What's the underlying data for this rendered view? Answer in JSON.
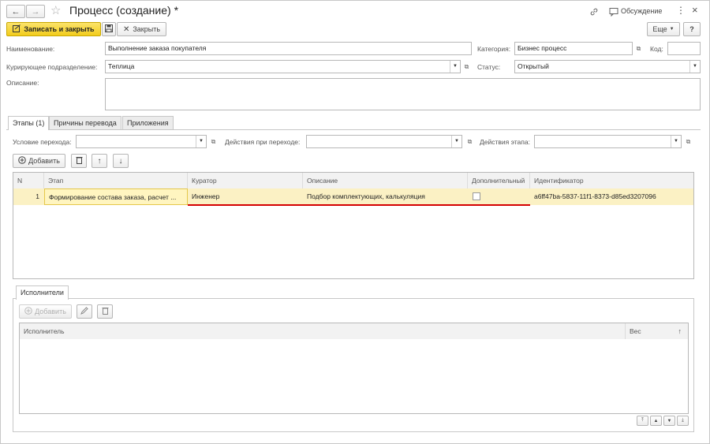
{
  "window": {
    "title": "Процесс (создание) *",
    "discussion_label": "Обсуждение",
    "more_glyph": "⋮",
    "close_glyph": "×",
    "back_glyph": "←",
    "forward_glyph": "→",
    "star_glyph": "☆",
    "link_glyph": "🔗"
  },
  "toolbar": {
    "save_close_label": "Записать и закрыть",
    "close_label": "Закрыть",
    "more_label": "Еще",
    "help_label": "?"
  },
  "form": {
    "name_label": "Наименование:",
    "name_value": "Выполнение заказа покупателя",
    "category_label": "Категория:",
    "category_value": "Бизнес процесс",
    "code_label": "Код:",
    "code_value": "",
    "department_label": "Курирующее подразделение:",
    "department_value": "Теплица",
    "status_label": "Статус:",
    "status_value": "Открытый",
    "description_label": "Описание:",
    "description_value": ""
  },
  "tabs": [
    {
      "label": "Этапы (1)"
    },
    {
      "label": "Причины перевода"
    },
    {
      "label": "Приложения"
    }
  ],
  "stages": {
    "condition_label": "Условие перехода:",
    "transition_actions_label": "Действия при переходе:",
    "stage_actions_label": "Действия этапа:",
    "add_label": "Добавить",
    "columns": [
      "N",
      "Этап",
      "Куратор",
      "Описание",
      "Дополнительный",
      "Идентификатор"
    ],
    "rows": [
      {
        "n": "1",
        "stage": "Формирование состава заказа, расчет ...",
        "curator": "Инженер",
        "description": "Подбор комплектующих, калькуляция",
        "additional": false,
        "id": "a6ff47ba-5837-11f1-8373-d85ed3207096"
      }
    ]
  },
  "executors": {
    "tab_label": "Исполнители",
    "add_label": "Добавить",
    "columns": [
      "Исполнитель",
      "Вес"
    ]
  },
  "colors": {
    "accent_yellow": "#f7d634",
    "selected_row": "#fbf1c4",
    "error_underline": "#d40000"
  }
}
